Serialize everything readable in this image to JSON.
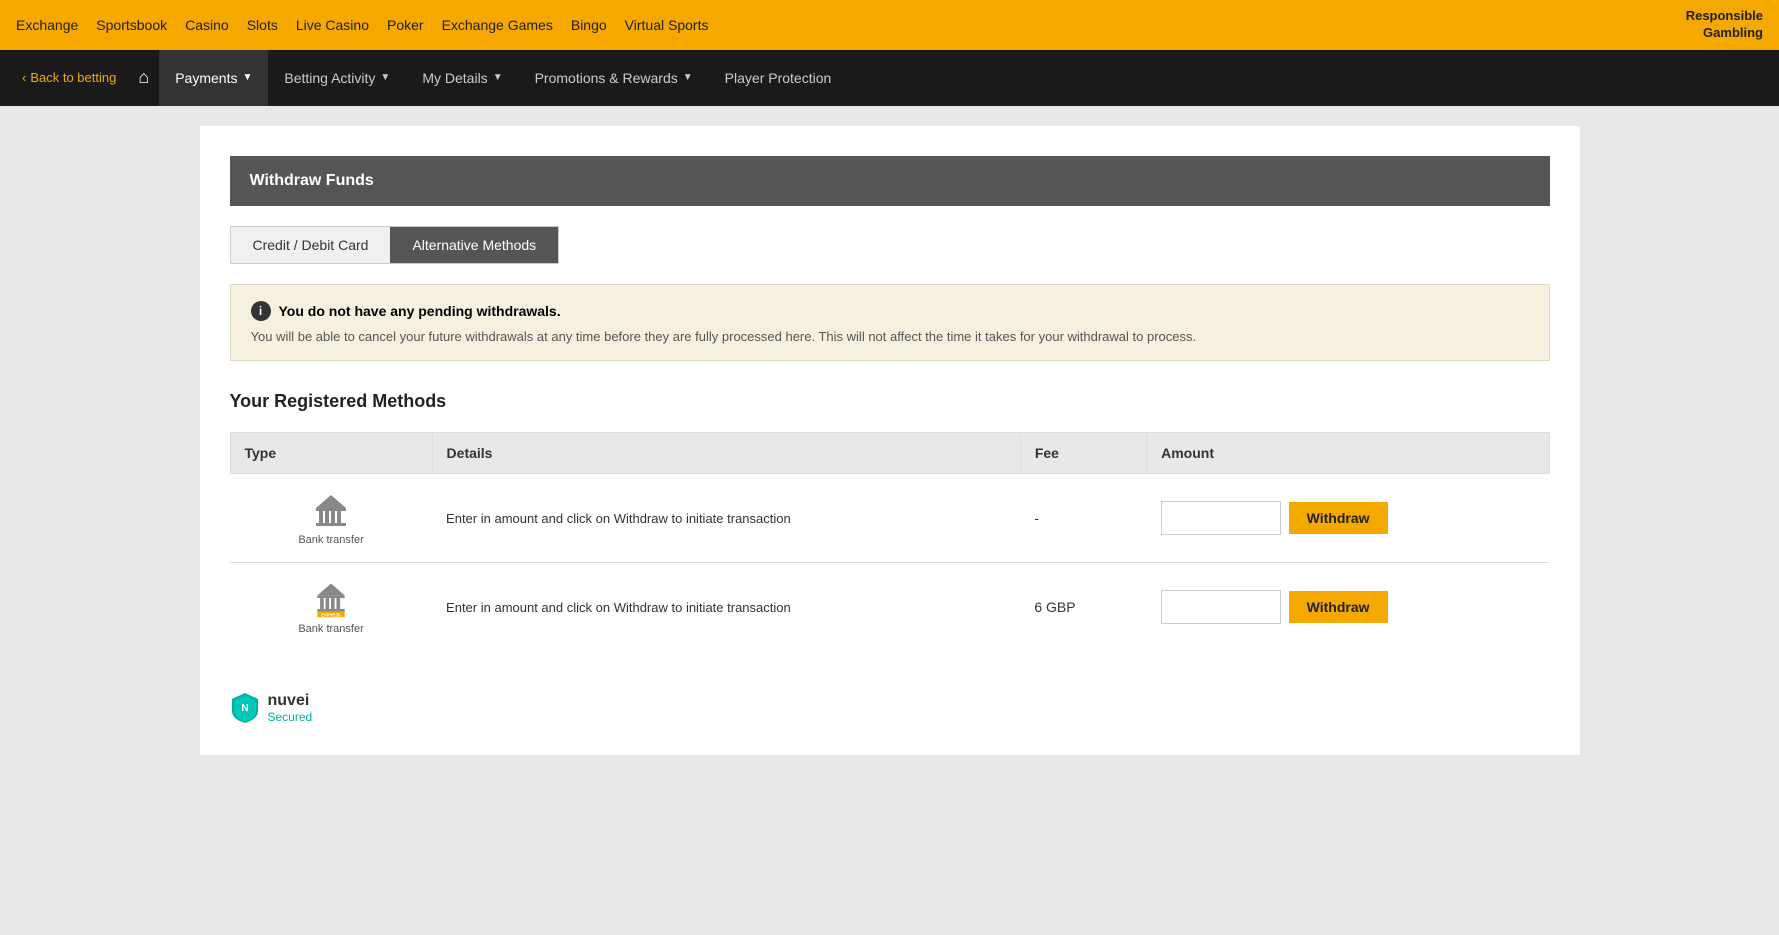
{
  "topNav": {
    "links": [
      "Exchange",
      "Sportsbook",
      "Casino",
      "Slots",
      "Live Casino",
      "Poker",
      "Exchange Games",
      "Bingo",
      "Virtual Sports"
    ],
    "responsible": "Responsible\nGambling"
  },
  "secNav": {
    "backLabel": "Back to betting",
    "items": [
      {
        "label": "Payments",
        "hasChevron": true,
        "active": true
      },
      {
        "label": "Betting Activity",
        "hasChevron": true
      },
      {
        "label": "My Details",
        "hasChevron": true
      },
      {
        "label": "Promotions & Rewards",
        "hasChevron": true
      },
      {
        "label": "Player Protection",
        "hasChevron": false
      }
    ]
  },
  "page": {
    "title": "Withdraw Funds",
    "tabs": [
      {
        "label": "Credit / Debit Card",
        "active": false
      },
      {
        "label": "Alternative Methods",
        "active": true
      }
    ],
    "infoBox": {
      "title": "You do not have any pending withdrawals.",
      "text": "You will be able to cancel your future withdrawals at any time before they are fully processed here. This will not affect the time it takes for your withdrawal to process."
    },
    "registeredMethods": {
      "sectionTitle": "Your Registered Methods",
      "tableHeaders": [
        "Type",
        "Details",
        "Fee",
        "Amount"
      ],
      "rows": [
        {
          "typeLabel": "Bank transfer",
          "typeStyle": "standard",
          "details": "Enter in amount and click on Withdraw to initiate transaction",
          "fee": "-",
          "amountPlaceholder": ""
        },
        {
          "typeLabel": "Bank transfer",
          "typeStyle": "express",
          "details": "Enter in amount and click on Withdraw to initiate transaction",
          "fee": "6 GBP",
          "amountPlaceholder": ""
        }
      ],
      "withdrawLabel": "Withdraw"
    }
  },
  "footer": {
    "nuvei": "nuvei",
    "secured": "Secured"
  }
}
